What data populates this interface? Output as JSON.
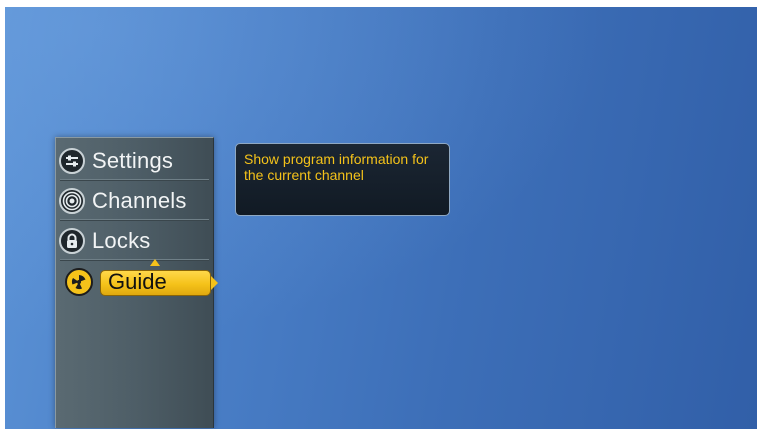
{
  "menu": {
    "items": [
      {
        "label": "Settings",
        "icon": "settings-sliders-icon"
      },
      {
        "label": "Channels",
        "icon": "broadcast-antenna-icon"
      },
      {
        "label": "Locks",
        "icon": "padlock-icon"
      },
      {
        "label": "Guide",
        "icon": "guide-radar-icon",
        "selected": true
      }
    ]
  },
  "tooltip": {
    "text": "Show program information for the current channel"
  },
  "colors": {
    "background_blue": "#4a7fc7",
    "panel_gray": "#4e5e67",
    "highlight_yellow": "#f5c21a",
    "tooltip_text": "#f4c21a",
    "tooltip_bg": "#111a24"
  }
}
